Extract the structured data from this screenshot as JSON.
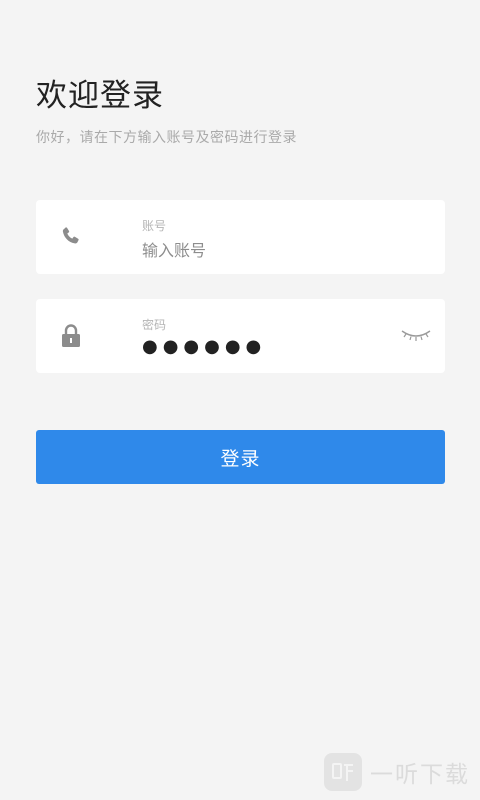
{
  "header": {
    "title": "欢迎登录",
    "subtitle": "你好，请在下方输入账号及密码进行登录"
  },
  "account": {
    "label": "账号",
    "placeholder": "输入账号",
    "icon": "phone-icon"
  },
  "password": {
    "label": "密码",
    "value": "●●●●●●",
    "icon": "lock-icon",
    "toggle_icon": "eye-closed-icon"
  },
  "login_button": {
    "label": "登录"
  },
  "watermark": {
    "text": "一听下载"
  },
  "colors": {
    "background": "#f4f4f4",
    "card": "#ffffff",
    "accent": "#2f89ea",
    "title": "#222222",
    "muted": "#aaaaaa"
  }
}
